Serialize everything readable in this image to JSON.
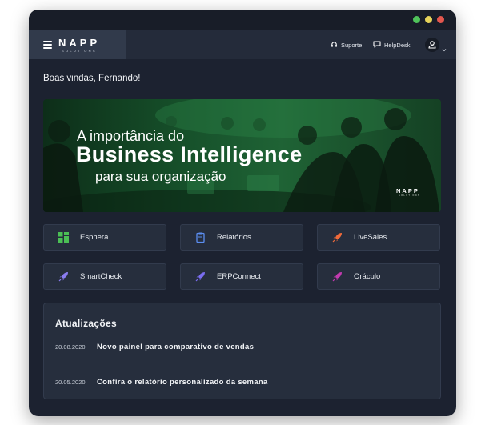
{
  "brand": {
    "name": "NAPP",
    "tagline": "SOLUTIONS"
  },
  "topbar": {
    "support_label": "Suporte",
    "helpdesk_label": "HelpDesk"
  },
  "greeting": "Boas vindas, Fernando!",
  "banner": {
    "line1": "A importância do",
    "line2": "Business Intelligence",
    "line3": "para sua organização",
    "logo": "NAPP",
    "logo_sub": "SOLUTIONS"
  },
  "apps": [
    {
      "label": "Esphera",
      "icon": "grid-icon",
      "color": "#4bbf55"
    },
    {
      "label": "Relatórios",
      "icon": "clipboard-icon",
      "color": "#5b8df0"
    },
    {
      "label": "LiveSales",
      "icon": "rocket-icon",
      "color": "#f06a3a"
    },
    {
      "label": "SmartCheck",
      "icon": "rocket-icon",
      "color": "#8a7cf0"
    },
    {
      "label": "ERPConnect",
      "icon": "rocket-icon",
      "color": "#7a6df0"
    },
    {
      "label": "Oráculo",
      "icon": "rocket-icon",
      "color": "#c23ab0"
    }
  ],
  "updates": {
    "title": "Atualizações",
    "items": [
      {
        "date": "20.08.2020",
        "text": "Novo painel para comparativo de vendas"
      },
      {
        "date": "20.05.2020",
        "text": "Confira o relatório personalizado da semana"
      }
    ]
  }
}
